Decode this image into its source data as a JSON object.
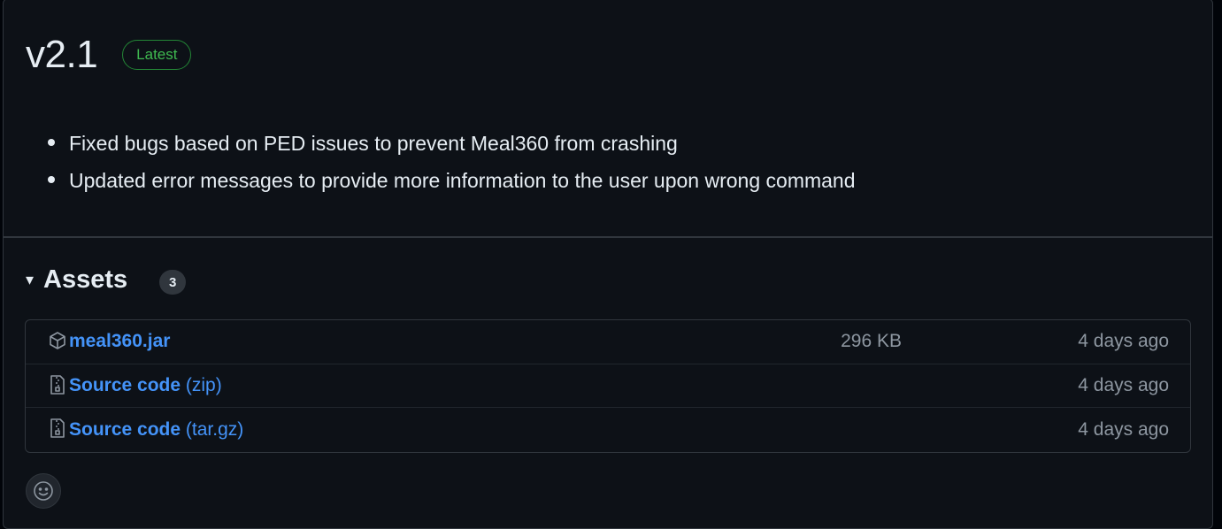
{
  "release": {
    "title": "v2.1",
    "badge": "Latest",
    "notes": [
      "Fixed bugs based on PED issues to prevent Meal360 from crashing",
      "Updated error messages to provide more information to the user upon wrong command"
    ]
  },
  "assets": {
    "caret": "▾",
    "title": "Assets",
    "count": "3",
    "items": [
      {
        "icon": "package-icon",
        "name": "meal360.jar",
        "suffix": "",
        "size": "296 KB",
        "date": "4 days ago"
      },
      {
        "icon": "file-zip-icon",
        "name": "Source code",
        "suffix": "(zip)",
        "size": "",
        "date": "4 days ago"
      },
      {
        "icon": "file-zip-icon",
        "name": "Source code",
        "suffix": "(tar.gz)",
        "size": "",
        "date": "4 days ago"
      }
    ]
  },
  "reaction": {
    "icon": "smiley-icon"
  },
  "colors": {
    "background": "#0d1117",
    "link": "#4493f8",
    "latest_green": "#3fb950",
    "muted": "#8d96a0",
    "border": "#30363d"
  }
}
